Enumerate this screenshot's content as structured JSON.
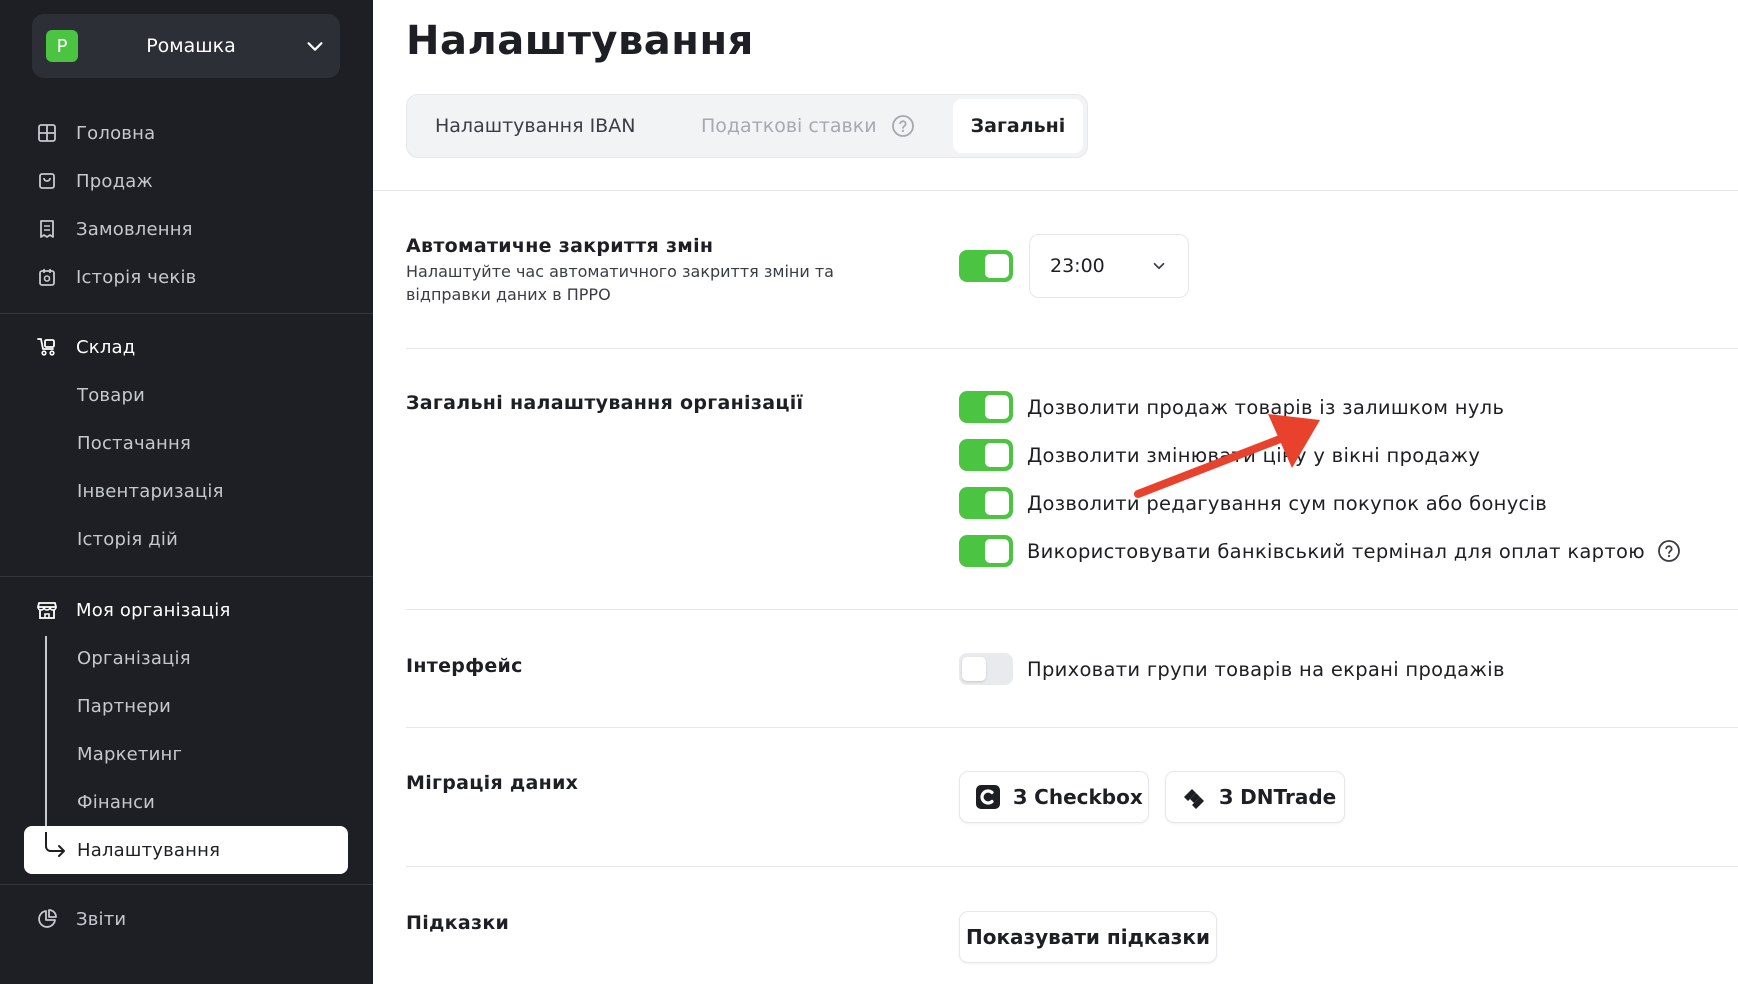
{
  "sidebar": {
    "org": {
      "initial": "Р",
      "name": "Ромашка"
    },
    "nav": [
      {
        "label": "Головна",
        "icon": "grid-icon"
      },
      {
        "label": "Продаж",
        "icon": "bag-icon"
      },
      {
        "label": "Замовлення",
        "icon": "receipt-icon"
      },
      {
        "label": "Історія чеків",
        "icon": "history-icon"
      }
    ],
    "warehouse": {
      "label": "Склад",
      "icon": "cart-icon",
      "items": [
        "Товари",
        "Постачання",
        "Інвентаризація",
        "Історія дій"
      ]
    },
    "organization": {
      "label": "Моя організація",
      "icon": "store-icon",
      "items": [
        "Організація",
        "Партнери",
        "Маркетинг",
        "Фінанси"
      ],
      "active": "Налаштування"
    },
    "reports": {
      "label": "Звіти",
      "icon": "pie-chart-icon"
    }
  },
  "main": {
    "title": "Налаштування",
    "tabs": [
      {
        "label": "Налаштування IBAN",
        "state": "normal"
      },
      {
        "label": "Податкові ставки",
        "state": "disabled"
      },
      {
        "label": "Загальні",
        "state": "active"
      }
    ],
    "auto_close": {
      "title": "Автоматичне закриття змін",
      "description": "Налаштуйте час автоматичного закриття зміни та відправки даних в ПРРО",
      "enabled": true,
      "time": "23:00"
    },
    "org_settings": {
      "title": "Загальні налаштування організації",
      "options": [
        {
          "label": "Дозволити продаж товарів із залишком нуль",
          "enabled": true
        },
        {
          "label": "Дозволити змінювати ціну у вікні продажу",
          "enabled": true
        },
        {
          "label": "Дозволити редагування сум покупок або бонусів",
          "enabled": true
        },
        {
          "label": "Використовувати банківський термінал для оплат картою",
          "enabled": true
        }
      ]
    },
    "interface": {
      "title": "Інтерфейс",
      "option": {
        "label": "Приховати групи товарів на екрані продажів",
        "enabled": false
      }
    },
    "migration": {
      "title": "Міграція даних",
      "buttons": [
        {
          "label": "З Checkbox",
          "icon": "checkbox-logo-icon"
        },
        {
          "label": "З DNTrade",
          "icon": "dntrade-logo-icon"
        }
      ]
    },
    "hints": {
      "title": "Підказки",
      "button": "Показувати підказки"
    }
  },
  "colors": {
    "sidebar_bg": "#1d1f24",
    "accent_green": "#4bc441",
    "annotation_red": "#e8412c"
  }
}
